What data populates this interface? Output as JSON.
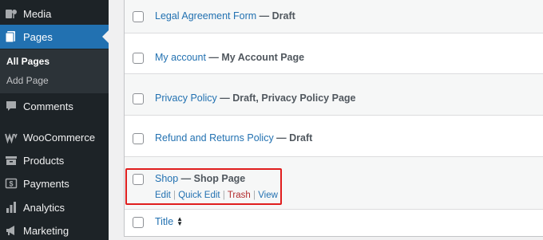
{
  "sidebar": {
    "items": [
      {
        "label": "Media",
        "icon": "media-icon"
      },
      {
        "label": "Pages",
        "icon": "pages-icon"
      },
      {
        "label": "Comments",
        "icon": "comments-icon"
      },
      {
        "label": "WooCommerce",
        "icon": "woocommerce-icon"
      },
      {
        "label": "Products",
        "icon": "products-icon"
      },
      {
        "label": "Payments",
        "icon": "payments-icon"
      },
      {
        "label": "Analytics",
        "icon": "analytics-icon"
      },
      {
        "label": "Marketing",
        "icon": "marketing-icon"
      }
    ],
    "submenu": [
      "All Pages",
      "Add Page"
    ]
  },
  "pages": [
    {
      "title": "Legal Agreement Form",
      "state": " — Draft"
    },
    {
      "title": "My account",
      "state": " — My Account Page"
    },
    {
      "title": "Privacy Policy",
      "state": " — Draft, Privacy Policy Page"
    },
    {
      "title": "Refund and Returns Policy",
      "state": " — Draft"
    },
    {
      "title": "Shop",
      "state": " — Shop Page"
    }
  ],
  "row_actions": {
    "edit": "Edit",
    "quick_edit": "Quick Edit",
    "trash": "Trash",
    "view": "View",
    "separator": " | "
  },
  "footer": {
    "title_column": "Title"
  },
  "colors": {
    "sidebar_bg": "#1d2327",
    "active": "#2271b1",
    "link": "#2271b1",
    "trash": "#b32d2e",
    "highlight": "#e01e1e"
  }
}
